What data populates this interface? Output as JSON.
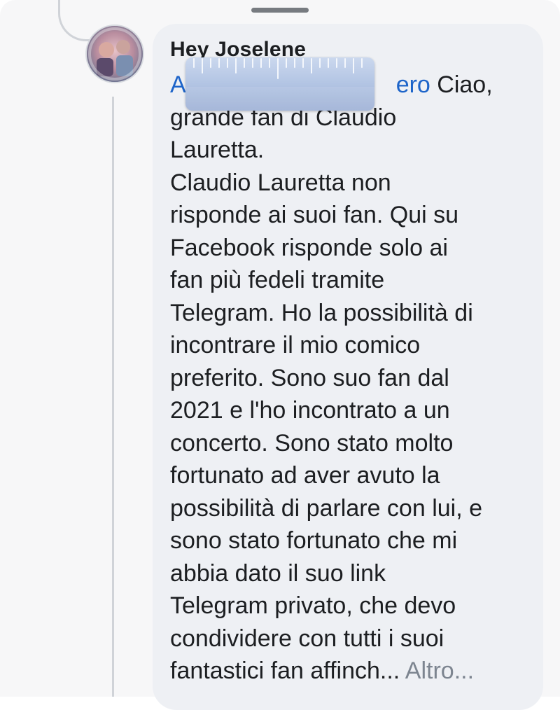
{
  "thread": {
    "author": "Hey Joselene",
    "mention_start": "A",
    "mention_end": "ero",
    "line1_tail": " Ciao,",
    "body": "grande fan di Claudio\nLauretta.\nClaudio Lauretta non\nrisponde ai suoi fan. Qui su\nFacebook risponde solo ai\nfan più fedeli tramite\nTelegram. Ho la possibilità di\nincontrare il mio comico\npreferito. Sono suo fan dal\n2021 e l'ho incontrato a un\nconcerto. Sono stato molto\nfortunato ad aver avuto la\npossibilità di parlare con lui, e\nsono stato fortunato che mi\nabbia dato il suo link\nTelegram privato, che devo\ncondividere con tutti i suoi\nfantastici fan affinch...",
    "more_label": " Altro..."
  },
  "icons": {
    "avatar": "profile-photo",
    "ruler": "ruler-icon",
    "handle": "grab-handle"
  },
  "colors": {
    "mention": "#1d64c9",
    "text": "#1c1e21",
    "bubble": "#eef0f4",
    "more": "#7d8590"
  }
}
